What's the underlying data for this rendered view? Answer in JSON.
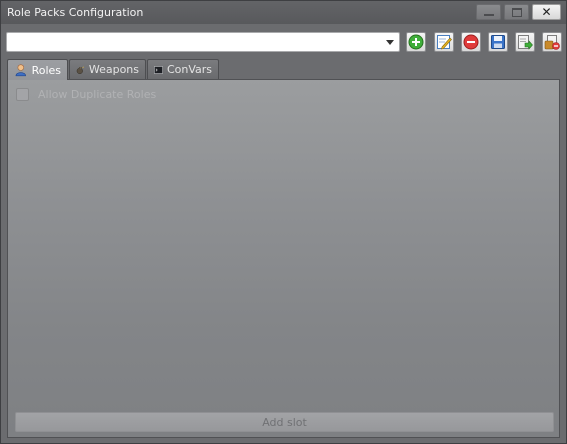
{
  "window": {
    "title": "Role Packs Configuration",
    "close_glyph": "✕"
  },
  "toolbar": {
    "pack_select_value": "",
    "buttons": [
      {
        "name": "add-pack",
        "icon": "plus-circle-icon"
      },
      {
        "name": "edit-pack",
        "icon": "pencil-icon"
      },
      {
        "name": "remove-pack",
        "icon": "minus-circle-icon"
      },
      {
        "name": "save-pack",
        "icon": "floppy-disk-icon"
      },
      {
        "name": "import-pack",
        "icon": "import-icon"
      },
      {
        "name": "export-pack",
        "icon": "export-icon"
      }
    ]
  },
  "tabs": [
    {
      "label": "Roles",
      "icon": "user-icon",
      "active": true
    },
    {
      "label": "Weapons",
      "icon": "grenade-icon",
      "active": false
    },
    {
      "label": "ConVars",
      "icon": "console-icon",
      "active": false
    }
  ],
  "roles_panel": {
    "allow_duplicate_label": "Allow Duplicate Roles",
    "allow_duplicate_checked": false,
    "add_slot_label": "Add slot"
  }
}
